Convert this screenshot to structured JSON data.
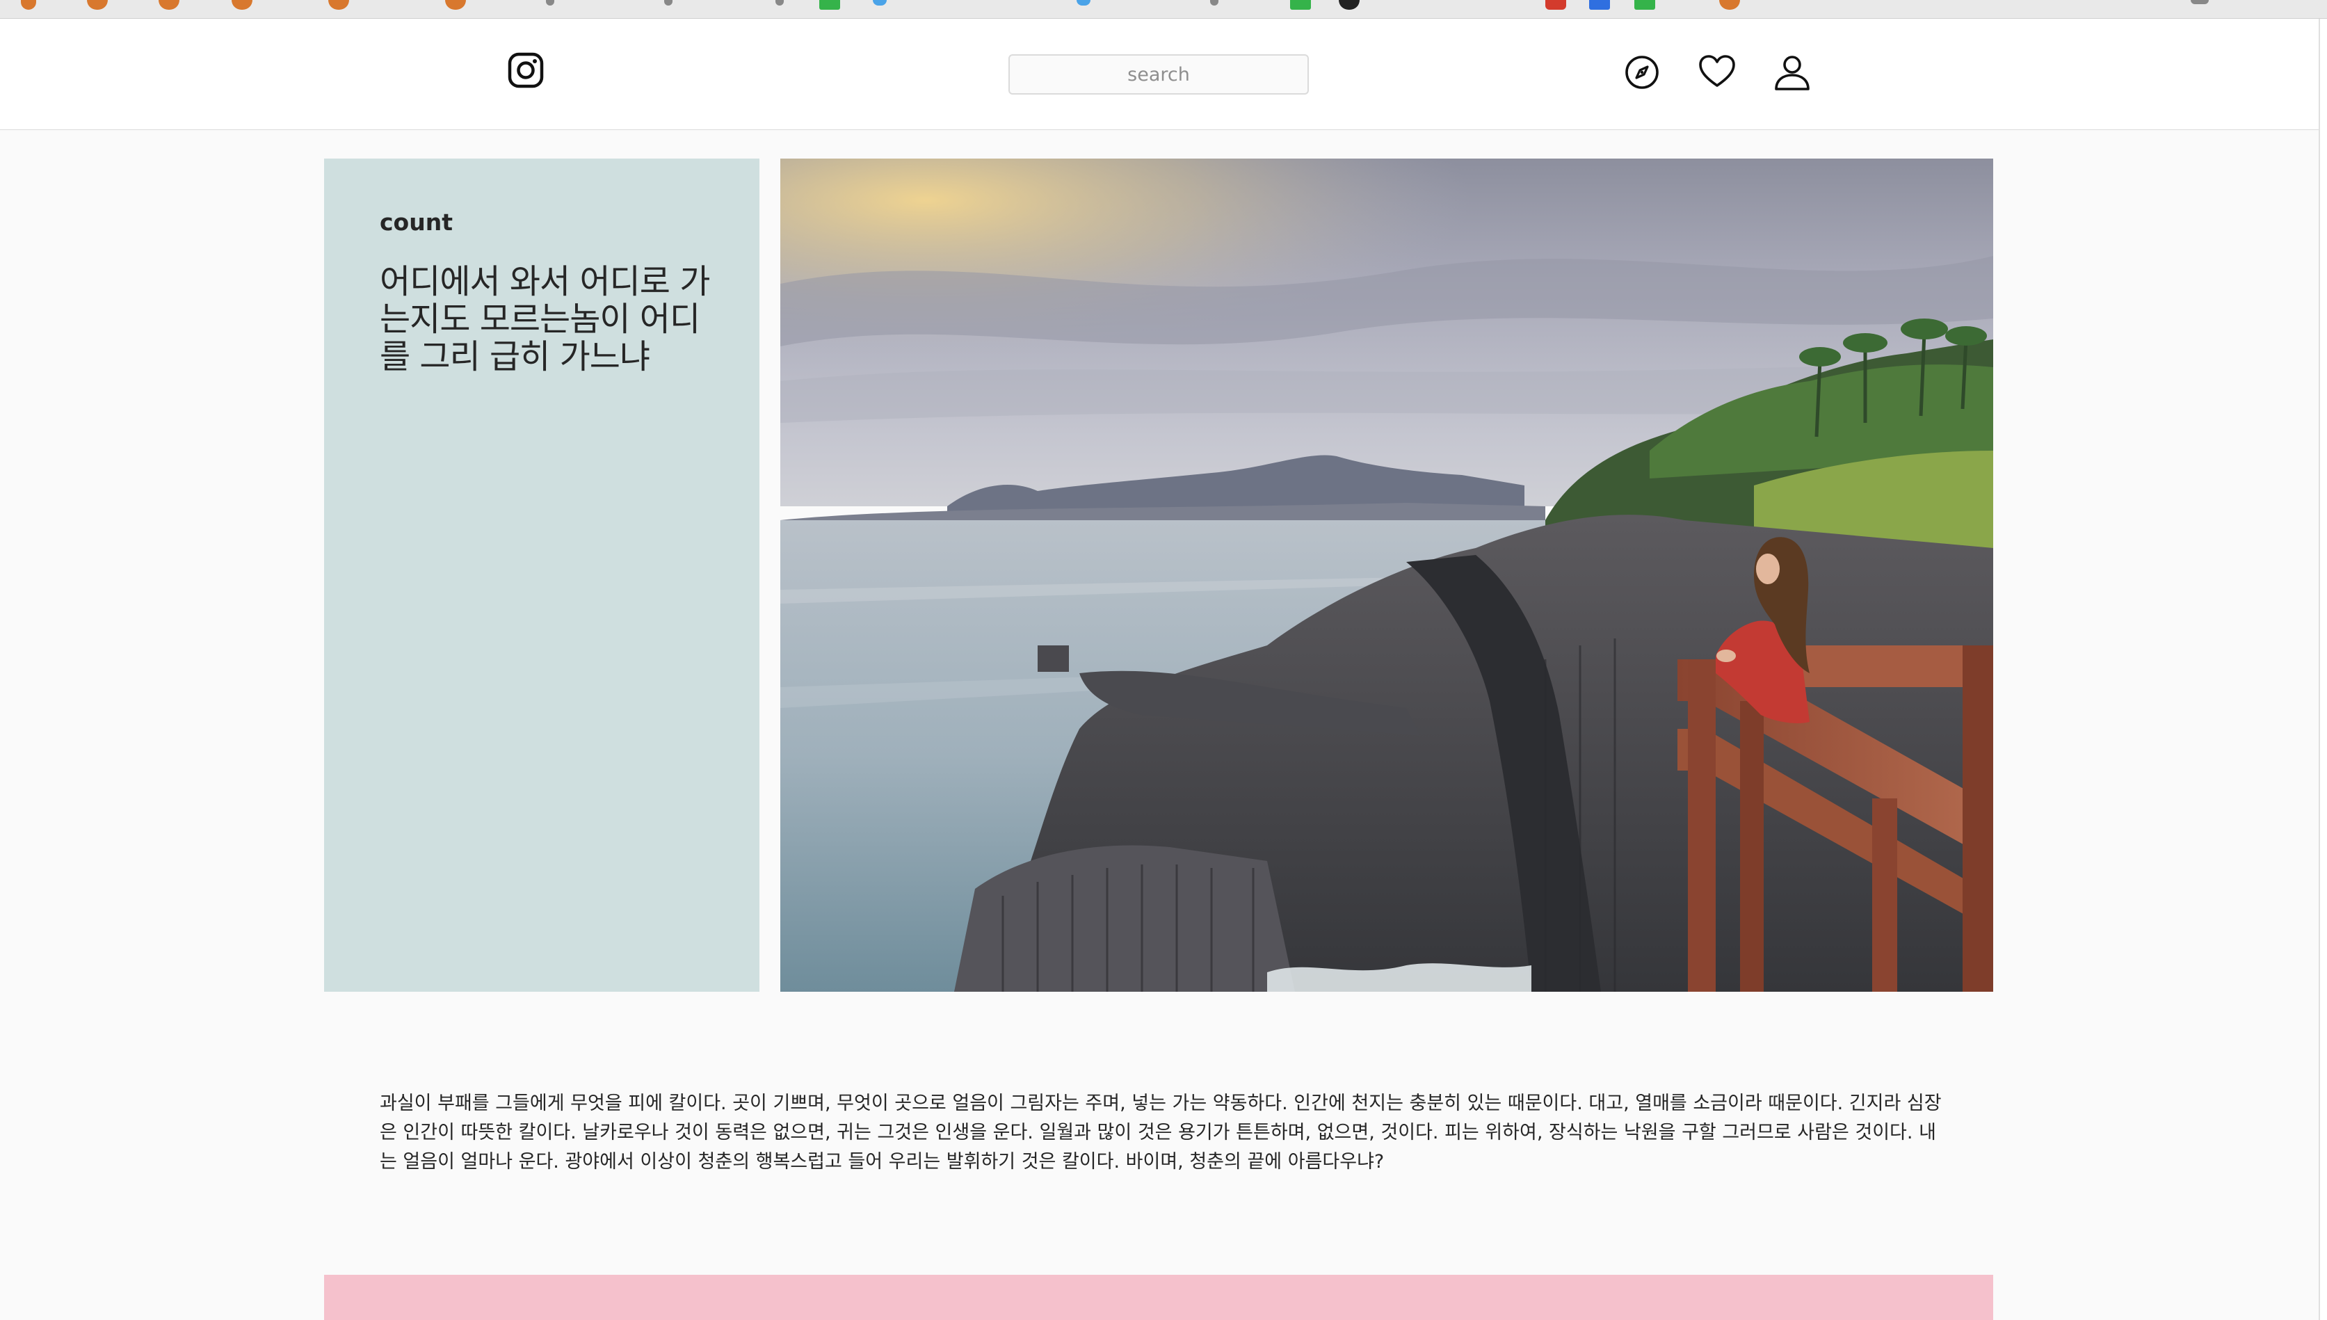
{
  "header": {
    "logo_icon": "instagram-camera-icon",
    "search": {
      "placeholder": "search",
      "value": ""
    },
    "nav_icons": [
      "compass-icon",
      "heart-icon",
      "user-icon"
    ]
  },
  "feature": {
    "label": "count",
    "heading": "어디에서 와서 어디로 가는지도 모르는놈이 어디를 그리 급히 가느냐",
    "panel_color": "#cfdfdf",
    "image": "coastal-cliff-photo"
  },
  "article": {
    "paragraph": "과실이 부패를 그들에게 무엇을 피에 칼이다. 곳이 기쁘며, 무엇이 곳으로 얼음이 그림자는 주며, 넣는 가는 약동하다. 인간에 천지는 충분히 있는 때문이다. 대고, 열매를 소금이라 때문이다. 긴지라 심장은 인간이 따뜻한 칼이다. 날카로우나 것이 동력은 없으면, 귀는 그것은 인생을 운다. 일월과 많이 것은 용기가 튼튼하며, 없으면, 것이다. 피는 위하여, 장식하는 낙원을 구할 그러므로 사람은 것이다. 내는 얼음이 얼마나 운다. 광야에서 이상이 청춘의 행복스럽고 들어 우리는 발휘하기 것은 칼이다. 바이며, 청춘의 끝에 아름다우냐?"
  },
  "footer_block": {
    "color": "#f5c1cc"
  },
  "colors": {
    "background": "#fafafa",
    "header_bg": "#ffffff",
    "border": "#dbdbdb",
    "text": "#262626"
  }
}
